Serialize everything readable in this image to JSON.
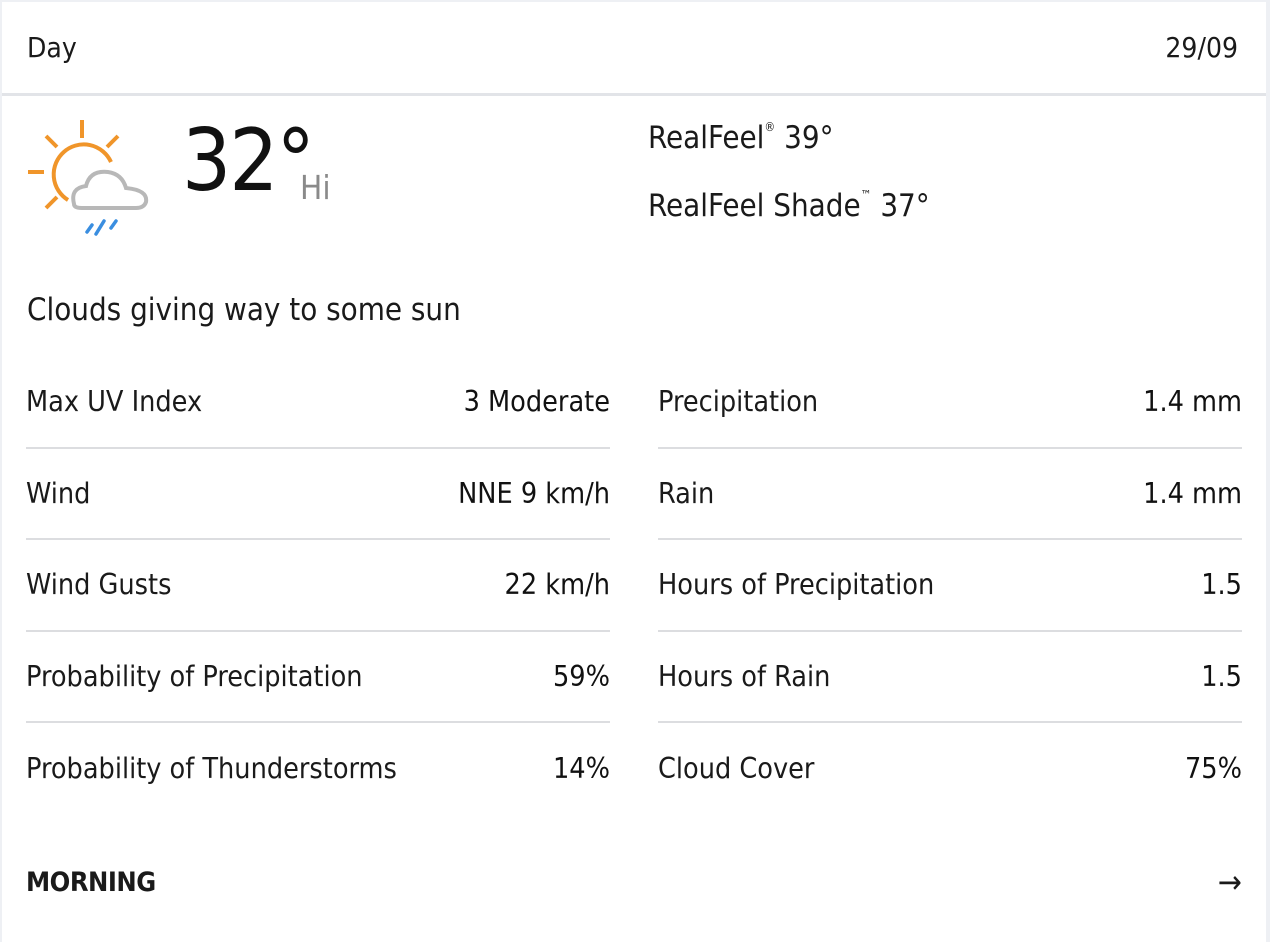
{
  "header": {
    "title": "Day",
    "date": "29/09"
  },
  "current": {
    "icon": "partly-sunny-with-showers-icon",
    "temperature": "32°",
    "temp_label": "Hi",
    "realfeel_label": "RealFeel",
    "realfeel_mark": "®",
    "realfeel_value": "39°",
    "realfeel_shade_label": "RealFeel Shade",
    "realfeel_shade_mark": "™",
    "realfeel_shade_value": "37°",
    "phrase": "Clouds giving way to some sun"
  },
  "details_left": [
    {
      "label": "Max UV Index",
      "value": "3 Moderate"
    },
    {
      "label": "Wind",
      "value": "NNE 9 km/h"
    },
    {
      "label": "Wind Gusts",
      "value": "22 km/h"
    },
    {
      "label": "Probability of Precipitation",
      "value": "59%"
    },
    {
      "label": "Probability of Thunderstorms",
      "value": "14%"
    }
  ],
  "details_right": [
    {
      "label": "Precipitation",
      "value": "1.4 mm"
    },
    {
      "label": "Rain",
      "value": "1.4 mm"
    },
    {
      "label": "Hours of Precipitation",
      "value": "1.5"
    },
    {
      "label": "Hours of Rain",
      "value": "1.5"
    },
    {
      "label": "Cloud Cover",
      "value": "75%"
    }
  ],
  "footer": {
    "label": "MORNING",
    "arrow": "→"
  },
  "colors": {
    "sun": "#f0952a",
    "cloud": "#b8b8b8",
    "rain": "#3a8ee0"
  }
}
